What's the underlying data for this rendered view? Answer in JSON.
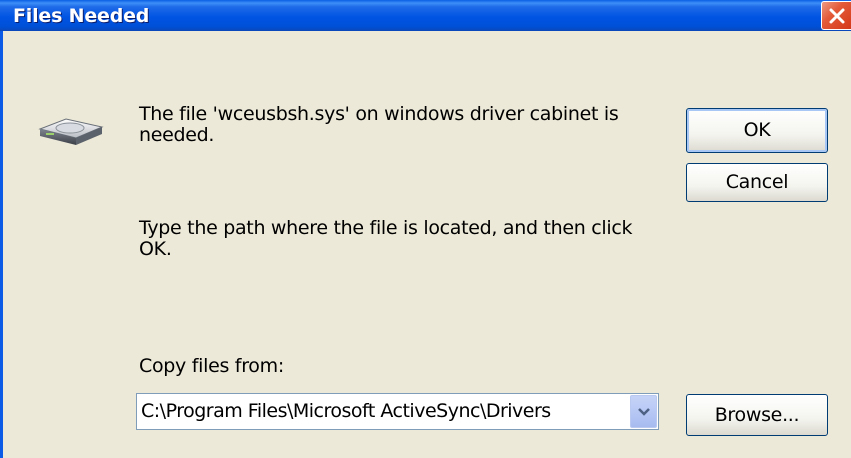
{
  "window": {
    "title": "Files Needed",
    "close_icon": "close-icon"
  },
  "dialog": {
    "message": "The file 'wceusbsh.sys' on windows driver cabinet is needed.",
    "instruction": "Type the path where the file is located, and then click OK.",
    "copy_label": "Copy files from:",
    "copy_path": "C:\\Program Files\\Microsoft ActiveSync\\Drivers",
    "icon": "hard-drive-icon"
  },
  "buttons": {
    "ok": "OK",
    "cancel": "Cancel",
    "browse": "Browse..."
  },
  "colors": {
    "titlebar": "#0054e3",
    "close": "#e35a38",
    "background": "#ece9d8"
  }
}
